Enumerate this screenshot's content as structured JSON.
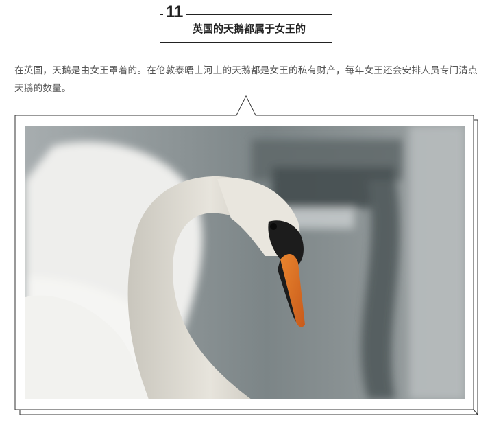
{
  "heading": {
    "number": "11",
    "title": "英国的天鹅都属于女王的"
  },
  "paragraph": {
    "text": "在英国，天鹅是由女王罩着的。在伦敦泰晤士河上的天鹅都是女王的私有财产，每年女王还会安排人员专门清点天鹅的数量。"
  },
  "photo": {
    "subject": "swan-photo"
  }
}
